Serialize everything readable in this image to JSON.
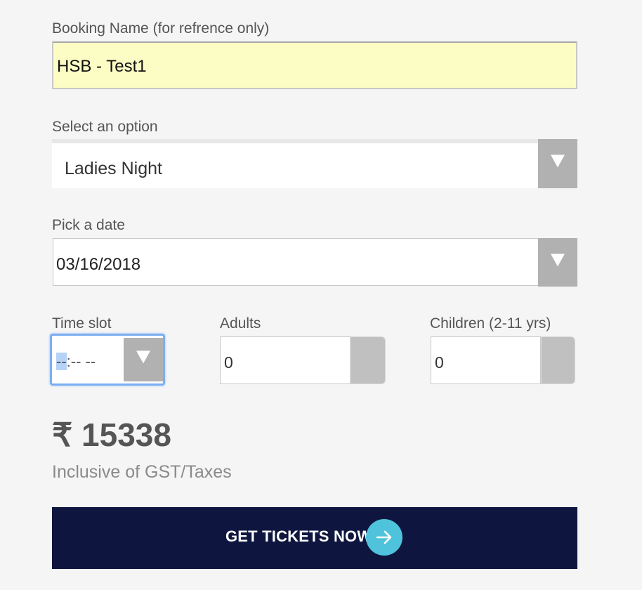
{
  "booking_name": {
    "label": "Booking Name (for refrence only)",
    "value": "HSB - Test1"
  },
  "option": {
    "label": "Select an option",
    "selected": "Ladies Night"
  },
  "date": {
    "label": "Pick a date",
    "value": "03/16/2018"
  },
  "time_slot": {
    "label": "Time slot",
    "hour": "--",
    "rest": ":-- --"
  },
  "adults": {
    "label": "Adults",
    "value": "0"
  },
  "children": {
    "label": "Children (2-11 yrs)",
    "value": "0"
  },
  "price": {
    "amount": "₹ 15338",
    "note": "Inclusive of GST/Taxes"
  },
  "cta": {
    "label": "GET TICKETS NOW",
    "icon": "arrow-right-icon"
  },
  "colors": {
    "name_field_bg": "#fcfdc4",
    "cta_bg": "#0e1640",
    "cta_icon_bg": "#4fc3dc",
    "focus_border": "#7aaef0"
  }
}
